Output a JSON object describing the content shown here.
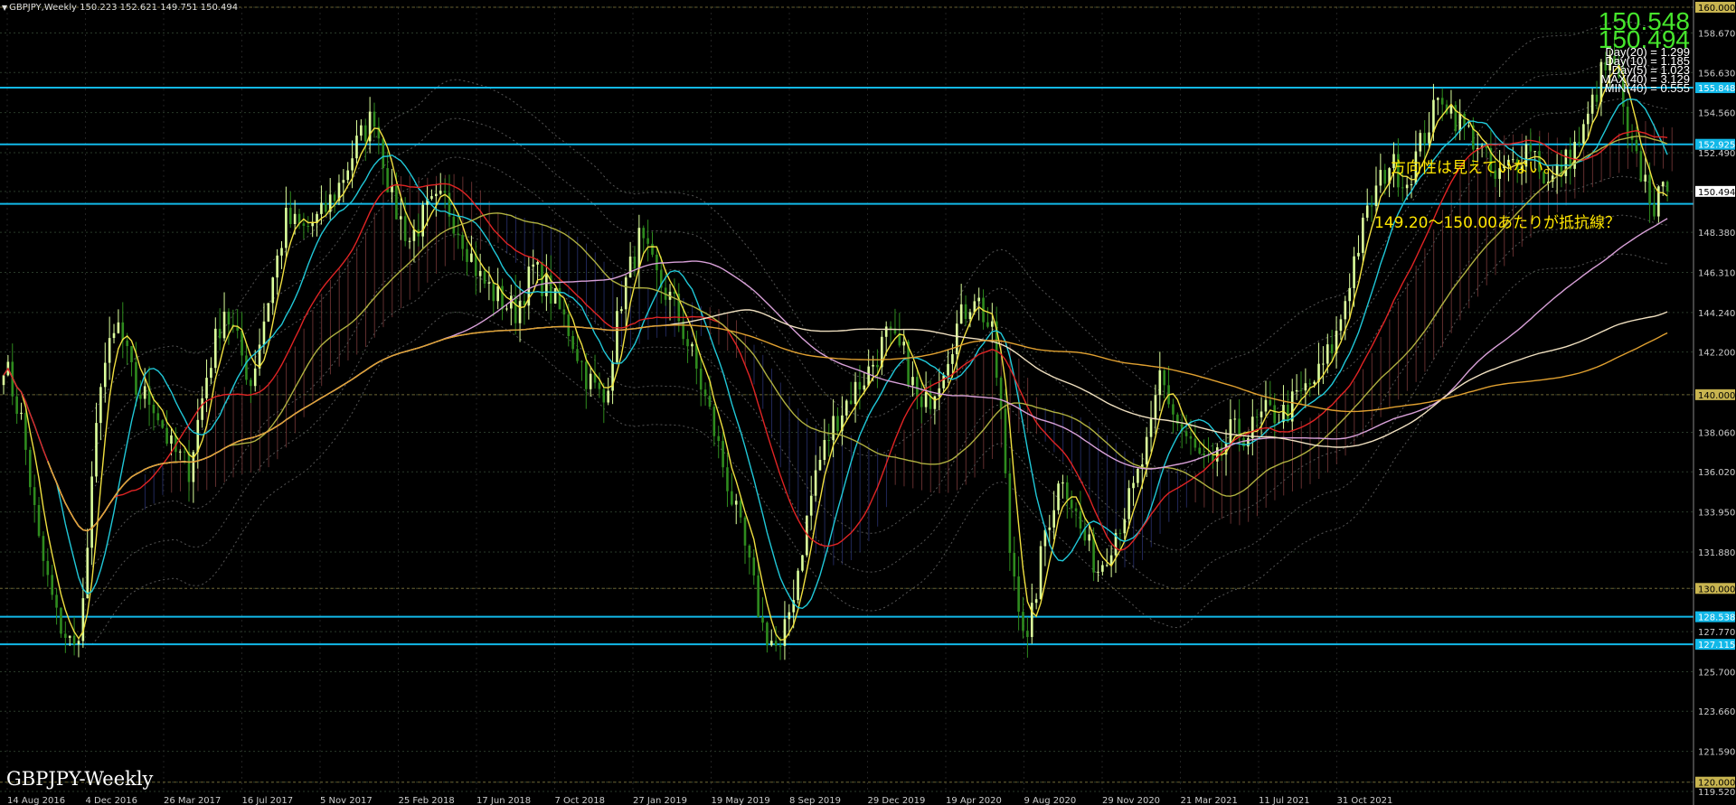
{
  "header": {
    "symbol": "GBPJPY,Weekly",
    "ohlc": "150.223 152.621 149.751 150.494"
  },
  "watermark": "GBPJPY-Weekly",
  "bid": "150.548",
  "ask": "150.494",
  "stats": [
    "Day(20) = 1.299",
    "Day(10) = 1.185",
    "Day(5) = 1.023",
    "MAX(40) = 3.129",
    "MIN(40) = 0.555"
  ],
  "annotations": {
    "note1": "方向性は見えていない。",
    "note2": "149.20～150.00あたりが抵抗線？"
  },
  "colors": {
    "background": "#000000",
    "bull_candle": "#dcff9c",
    "bear_candle": "#2e8b1e",
    "hline": "#12b8e8",
    "round_level": "#c8b450",
    "text_note": "#ffe600",
    "price_tag_current": "#ffffff",
    "ma_red": "#e02424",
    "ma_cyan": "#20c8d8",
    "ma_yellow": "#f0e040",
    "ma_orange": "#e0a030",
    "ma_pink": "#d8a0d8",
    "ma_cream": "#f0e0c0"
  },
  "chart_data": {
    "type": "candlestick",
    "symbol": "GBPJPY",
    "timeframe": "Weekly",
    "ylim": [
      119.52,
      160.0
    ],
    "y_ticks": [
      "160.000",
      "158.670",
      "156.630",
      "155.848",
      "154.560",
      "152.925",
      "152.490",
      "150.494",
      "148.380",
      "146.310",
      "144.240",
      "142.200",
      "140.000",
      "138.060",
      "136.020",
      "133.950",
      "131.880",
      "130.000",
      "128.538",
      "127.770",
      "127.115",
      "125.700",
      "123.660",
      "121.590",
      "120.000",
      "119.520"
    ],
    "x_ticks": [
      "14 Aug 2016",
      "4 Dec 2016",
      "26 Mar 2017",
      "16 Jul 2017",
      "5 Nov 2017",
      "25 Feb 2018",
      "17 Jun 2018",
      "7 Oct 2018",
      "27 Jan 2019",
      "19 May 2019",
      "8 Sep 2019",
      "29 Dec 2019",
      "19 Apr 2020",
      "9 Aug 2020",
      "29 Nov 2020",
      "21 Mar 2021",
      "11 Jul 2021",
      "31 Oct 2021"
    ],
    "horizontal_lines": [
      155.848,
      152.925,
      149.85,
      128.538,
      127.115
    ],
    "round_levels": [
      160.0,
      140.0,
      130.0,
      120.0
    ],
    "highlighted_labels": [
      "155.848",
      "152.925",
      "128.538",
      "127.115"
    ],
    "current_price_label": "150.494",
    "trend_points": [
      [
        0,
        141.8
      ],
      [
        4,
        138.7
      ],
      [
        8,
        132.3
      ],
      [
        12,
        128.5
      ],
      [
        16,
        126.8
      ],
      [
        18,
        129.2
      ],
      [
        22,
        141
      ],
      [
        26,
        143.5
      ],
      [
        30,
        140.2
      ],
      [
        34,
        139.6
      ],
      [
        38,
        137.2
      ],
      [
        42,
        136.2
      ],
      [
        46,
        141
      ],
      [
        50,
        144.5
      ],
      [
        54,
        142
      ],
      [
        56,
        140.6
      ],
      [
        60,
        145
      ],
      [
        64,
        149
      ],
      [
        68,
        148.5
      ],
      [
        72,
        149.2
      ],
      [
        76,
        150.8
      ],
      [
        80,
        152.9
      ],
      [
        84,
        154.5
      ],
      [
        88,
        150
      ],
      [
        92,
        148
      ],
      [
        96,
        149.5
      ],
      [
        100,
        150
      ],
      [
        104,
        148.2
      ],
      [
        108,
        146
      ],
      [
        112,
        145
      ],
      [
        116,
        144.3
      ],
      [
        120,
        146.5
      ],
      [
        124,
        145.2
      ],
      [
        128,
        143.4
      ],
      [
        132,
        141
      ],
      [
        136,
        139.6
      ],
      [
        140,
        145
      ],
      [
        144,
        148
      ],
      [
        148,
        146
      ],
      [
        152,
        144.6
      ],
      [
        156,
        142
      ],
      [
        160,
        139
      ],
      [
        164,
        135.5
      ],
      [
        168,
        132
      ],
      [
        172,
        128
      ],
      [
        176,
        126.6
      ],
      [
        180,
        131
      ],
      [
        184,
        136
      ],
      [
        188,
        138.5
      ],
      [
        192,
        140
      ],
      [
        196,
        141.2
      ],
      [
        200,
        143
      ],
      [
        204,
        142
      ],
      [
        208,
        139
      ],
      [
        212,
        141
      ],
      [
        216,
        143.5
      ],
      [
        220,
        145.3
      ],
      [
        224,
        143
      ],
      [
        226,
        139
      ],
      [
        228,
        132
      ],
      [
        232,
        127
      ],
      [
        236,
        133
      ],
      [
        240,
        136
      ],
      [
        244,
        133
      ],
      [
        248,
        131
      ],
      [
        252,
        133
      ],
      [
        256,
        135
      ],
      [
        260,
        138
      ],
      [
        262,
        141
      ],
      [
        266,
        138.5
      ],
      [
        270,
        137
      ],
      [
        274,
        136
      ],
      [
        278,
        138
      ],
      [
        282,
        138
      ],
      [
        286,
        139
      ],
      [
        290,
        139
      ],
      [
        294,
        140
      ],
      [
        298,
        141
      ],
      [
        302,
        143
      ],
      [
        306,
        147
      ],
      [
        310,
        150
      ],
      [
        314,
        152
      ],
      [
        318,
        151
      ],
      [
        322,
        153.5
      ],
      [
        326,
        155.5
      ],
      [
        330,
        154
      ],
      [
        334,
        153
      ],
      [
        338,
        151
      ],
      [
        342,
        152
      ],
      [
        346,
        153
      ],
      [
        350,
        150.8
      ],
      [
        354,
        152
      ],
      [
        358,
        153.5
      ],
      [
        362,
        156.5
      ],
      [
        365,
        157.2
      ],
      [
        368,
        153
      ],
      [
        372,
        151
      ],
      [
        374,
        149.8
      ],
      [
        377,
        150.494
      ]
    ]
  }
}
